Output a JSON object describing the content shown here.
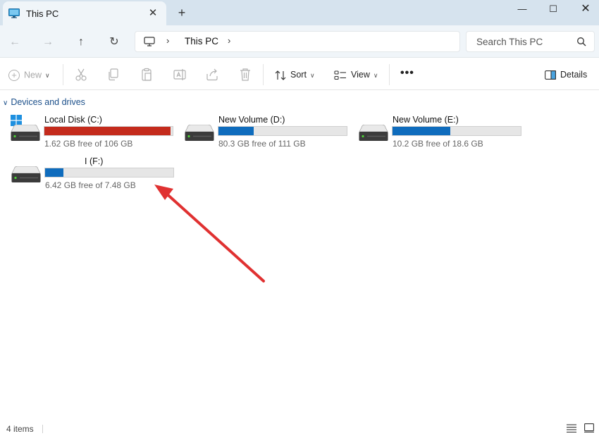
{
  "window": {
    "tab_title": "This PC",
    "tab_close_glyph": "✕",
    "new_tab_glyph": "+",
    "minimize_glyph": "—",
    "maximize_glyph": "☐",
    "close_glyph": "✕"
  },
  "address": {
    "path": "This PC",
    "search_placeholder": "Search This PC"
  },
  "nav": {
    "back_glyph": "←",
    "forward_glyph": "→",
    "up_glyph": "↑",
    "refresh_glyph": "↻"
  },
  "toolbar": {
    "new_label": "New",
    "sort_label": "Sort",
    "view_label": "View",
    "more_label": "•••",
    "details_label": "Details",
    "icons": [
      "cut-icon",
      "copy-icon",
      "paste-icon",
      "rename-icon",
      "share-icon",
      "delete-icon"
    ]
  },
  "content": {
    "section_title": "Devices and drives",
    "drives": [
      {
        "name": "Local Disk (C:)",
        "free_text": "1.62 GB free of 106 GB",
        "used_fraction": 0.985,
        "bar_color": "#c42b1c"
      },
      {
        "name": "New Volume (D:)",
        "free_text": "80.3 GB free of 111 GB",
        "used_fraction": 0.277,
        "bar_color": "#0f6cbd"
      },
      {
        "name": "New Volume (E:)",
        "free_text": "10.2 GB free of 18.6 GB",
        "used_fraction": 0.452,
        "bar_color": "#0f6cbd"
      },
      {
        "name": "I (F:)",
        "free_text": "6.42 GB free of 7.48 GB",
        "used_fraction": 0.142,
        "bar_color": "#0f6cbd"
      }
    ]
  },
  "annotation": {
    "arrow_color": "#e03131"
  },
  "status": {
    "item_count": "4 items"
  }
}
